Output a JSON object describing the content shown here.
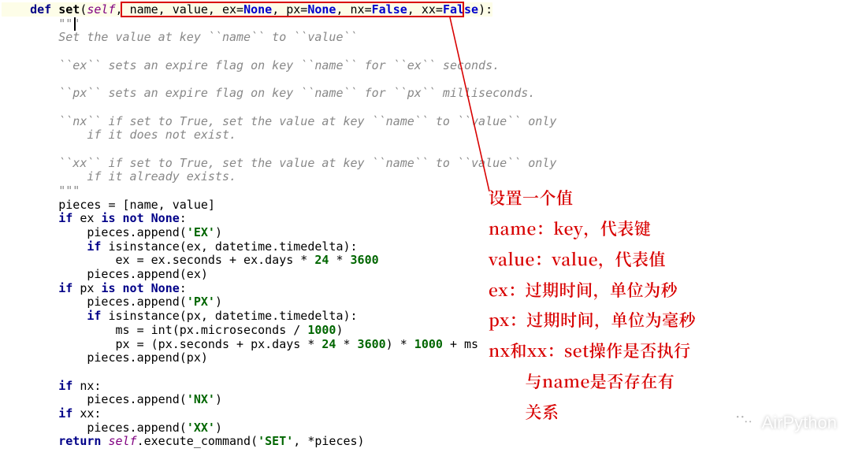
{
  "code": {
    "line1_def": "def ",
    "line1_fn": "set",
    "line1_open": "(",
    "line1_self": "self",
    "line1_sep1": ", ",
    "line1_p1": "name, value, ex=",
    "line1_none1": "None",
    "line1_sep2": ", px=",
    "line1_none2": "None",
    "line1_sep3": ", nx=",
    "line1_false1": "False",
    "line1_sep4": ", xx=",
    "line1_false2": "False",
    "line1_close": "):",
    "triplequote": "        \"\"\"",
    "doc_l1": "        Set the value at key ``name`` to ``value``",
    "doc_l2": "",
    "doc_l3": "        ``ex`` sets an expire flag on key ``name`` for ``ex`` seconds.",
    "doc_l4": "",
    "doc_l5": "        ``px`` sets an expire flag on key ``name`` for ``px`` milliseconds.",
    "doc_l6": "",
    "doc_l7": "        ``nx`` if set to True, set the value at key ``name`` to ``value`` only",
    "doc_l8": "            if it does not exist.",
    "doc_l9": "",
    "doc_l10": "        ``xx`` if set to True, set the value at key ``name`` to ``value`` only",
    "doc_l11": "            if it already exists.",
    "triplequote2": "        \"\"\"",
    "ln_pieces": "        pieces = [name, value]",
    "ln_ifex_a": "        ",
    "ln_ifex_if": "if",
    "ln_ifex_b": " ex ",
    "ln_ifex_isnot": "is not ",
    "ln_ifex_none": "None",
    "ln_ifex_c": ":",
    "ln_appex_a": "            pieces.append(",
    "ln_appex_s": "'EX'",
    "ln_appex_b": ")",
    "ln_isiex_a": "            ",
    "ln_isiex_if": "if",
    "ln_isiex_b": " isinstance(ex, datetime.timedelta):",
    "ln_excalc_a": "                ex = ex.seconds + ex.days * ",
    "ln_excalc_n1": "24",
    "ln_excalc_b": " * ",
    "ln_excalc_n2": "3600",
    "ln_appexv": "            pieces.append(ex)",
    "ln_ifpx_a": "        ",
    "ln_ifpx_if": "if",
    "ln_ifpx_b": " px ",
    "ln_ifpx_isnot": "is not ",
    "ln_ifpx_none": "None",
    "ln_ifpx_c": ":",
    "ln_apppx_a": "            pieces.append(",
    "ln_apppx_s": "'PX'",
    "ln_apppx_b": ")",
    "ln_isipx_a": "            ",
    "ln_isipx_if": "if",
    "ln_isipx_b": " isinstance(px, datetime.timedelta):",
    "ln_ms_a": "                ms = int(px.microseconds / ",
    "ln_ms_n": "1000",
    "ln_ms_b": ")",
    "ln_pxcalc_a": "                px = (px.seconds + px.days * ",
    "ln_pxcalc_n1": "24",
    "ln_pxcalc_b": " * ",
    "ln_pxcalc_n2": "3600",
    "ln_pxcalc_c": ") * ",
    "ln_pxcalc_n3": "1000",
    "ln_pxcalc_d": " + ms",
    "ln_apppxv": "            pieces.append(px)",
    "blank": "",
    "ln_ifnx_a": "        ",
    "ln_ifnx_if": "if",
    "ln_ifnx_b": " nx:",
    "ln_appnx_a": "            pieces.append(",
    "ln_appnx_s": "'NX'",
    "ln_appnx_b": ")",
    "ln_ifxx_a": "        ",
    "ln_ifxx_if": "if",
    "ln_ifxx_b": " xx:",
    "ln_appxx_a": "            pieces.append(",
    "ln_appxx_s": "'XX'",
    "ln_appxx_b": ")",
    "ln_ret_a": "        ",
    "ln_ret_kw": "return ",
    "ln_ret_self": "self",
    "ln_ret_b": ".execute_command(",
    "ln_ret_s": "'SET'",
    "ln_ret_c": ", *pieces)"
  },
  "annotations": {
    "l1": "设置一个值",
    "l2": "name：key，代表键",
    "l3": "value：value，代表值",
    "l4": "ex：过期时间，单位为秒",
    "l5": "px：过期时间，单位为毫秒",
    "l6": "nx和xx：set操作是否执行",
    "l7": "        与name是否存在有",
    "l8": "        关系"
  },
  "watermark": {
    "text": "AirPython"
  }
}
